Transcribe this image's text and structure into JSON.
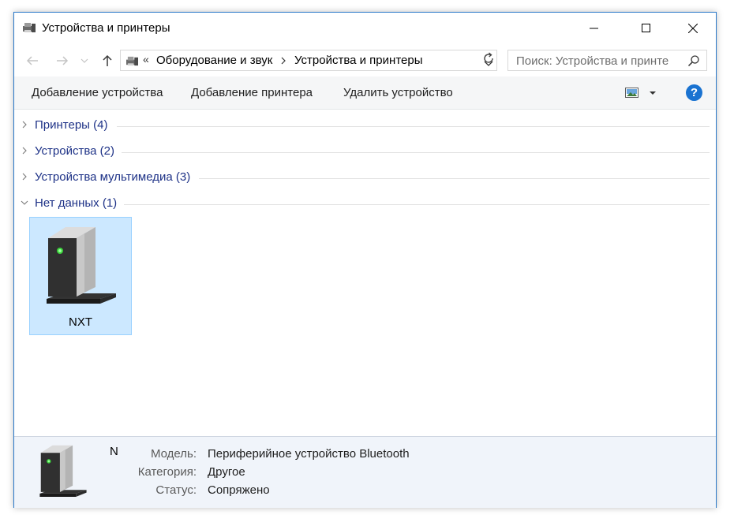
{
  "window": {
    "title": "Устройства и принтеры",
    "accent": "#2b79c9"
  },
  "address": {
    "overflow": "«",
    "crumbs": [
      "Оборудование и звук",
      "Устройства и принтеры"
    ]
  },
  "search": {
    "placeholder": "Поиск: Устройства и принте"
  },
  "toolbar": {
    "add_device": "Добавление устройства",
    "add_printer": "Добавление принтера",
    "remove_device": "Удалить устройство",
    "help": "?"
  },
  "groups": [
    {
      "label": "Принтеры (4)",
      "expanded": false
    },
    {
      "label": "Устройства (2)",
      "expanded": false
    },
    {
      "label": "Устройства мультимедиа (3)",
      "expanded": false
    },
    {
      "label": "Нет данных (1)",
      "expanded": true
    }
  ],
  "devices": [
    {
      "name": "NXT",
      "icon": "device-tower-icon",
      "selected": true
    }
  ],
  "details": {
    "name": "N",
    "rows": [
      {
        "label": "Модель:",
        "value": "Периферийное устройство Bluetooth"
      },
      {
        "label": "Категория:",
        "value": "Другое"
      },
      {
        "label": "Статус:",
        "value": "Сопряжено"
      }
    ]
  },
  "colors": {
    "group_label": "#1e3287",
    "selection_fill": "#cce8ff",
    "selection_border": "#99d1ff",
    "details_bg": "#f0f4fa",
    "help_blue": "#1a73d1"
  }
}
